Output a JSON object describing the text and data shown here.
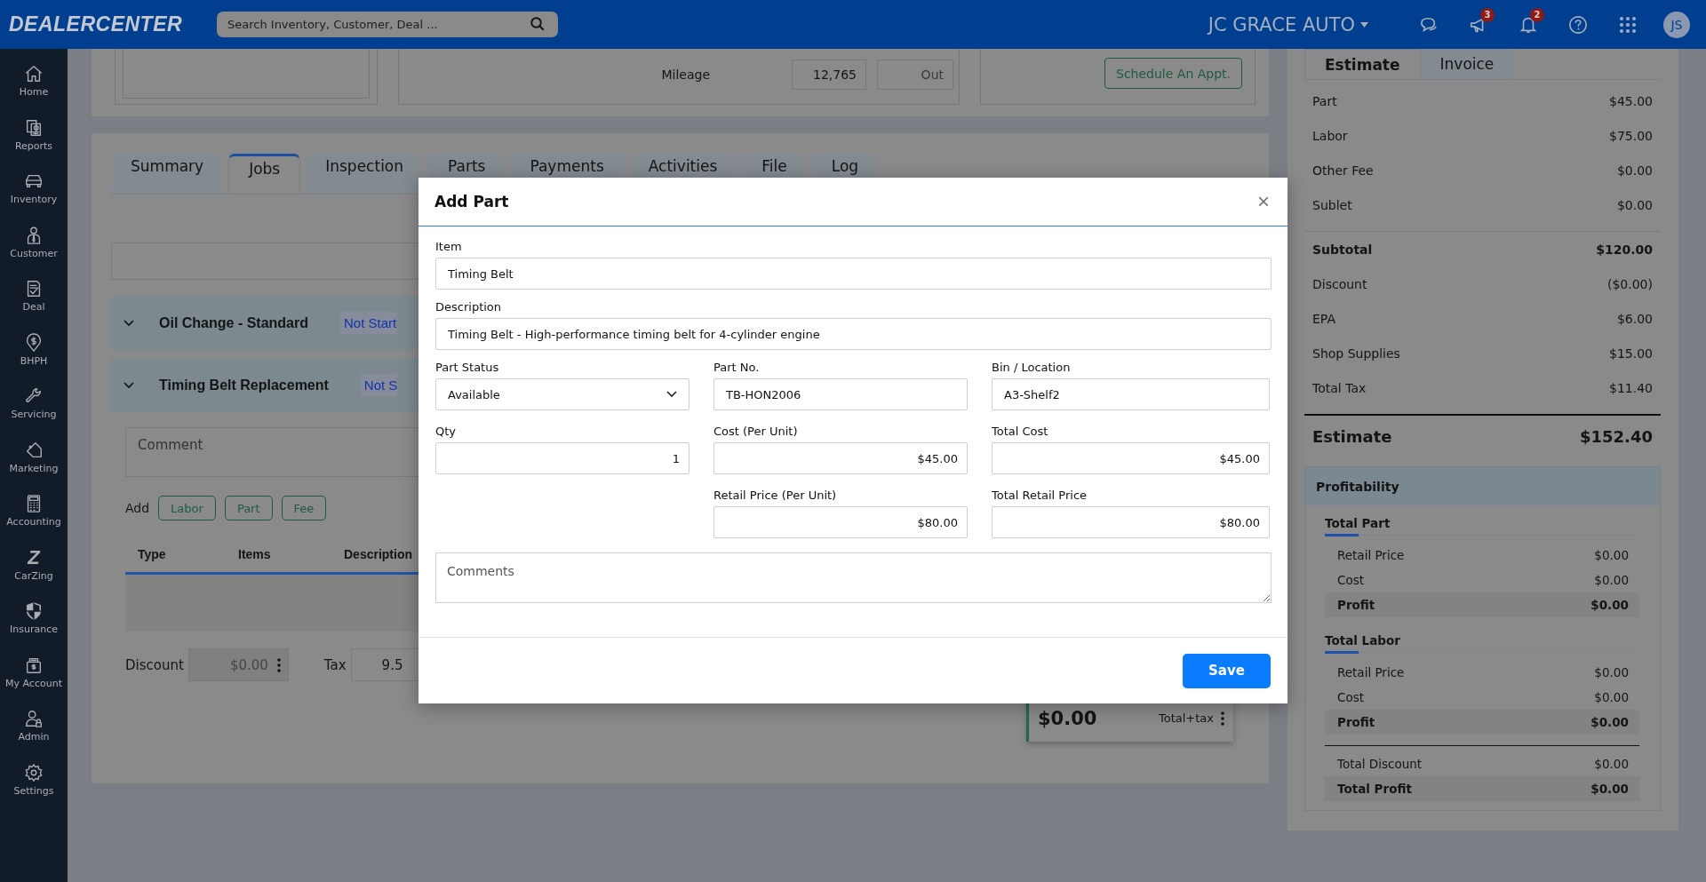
{
  "header": {
    "logo": "DEALERCENTER",
    "search": {
      "placeholder": "Search Inventory, Customer, Deal ..."
    },
    "dealer": "JC GRACE AUTO",
    "announcements_badge": "3",
    "alerts_badge": "2",
    "avatar": "JS"
  },
  "sidebar": {
    "items": [
      {
        "label": "Home"
      },
      {
        "label": "Reports"
      },
      {
        "label": "Inventory"
      },
      {
        "label": "Customer"
      },
      {
        "label": "Deal"
      },
      {
        "label": "BHPH"
      },
      {
        "label": "Servicing"
      },
      {
        "label": "Marketing"
      },
      {
        "label": "Accounting"
      },
      {
        "label": "CarZing",
        "glyph": "Z"
      },
      {
        "label": "Insurance"
      },
      {
        "label": "My Account"
      },
      {
        "label": "Admin"
      },
      {
        "label": "Settings"
      }
    ]
  },
  "vehicle_panel": {
    "mileage_label": "Mileage",
    "mileage": "12,765",
    "mileage_out_placeholder": "Out",
    "schedule_button": "Schedule An Appt."
  },
  "job_tabs": [
    {
      "label": "Summary",
      "selected": false
    },
    {
      "label": "Jobs",
      "selected": true
    },
    {
      "label": "Inspection",
      "selected": false
    },
    {
      "label": "Parts",
      "selected": false
    },
    {
      "label": "Payments",
      "selected": false
    },
    {
      "label": "Activities",
      "selected": false
    },
    {
      "label": "File",
      "selected": false
    },
    {
      "label": "Log",
      "selected": false
    }
  ],
  "jobs": [
    {
      "title": "Oil Change - Standard",
      "status": "Not Start"
    },
    {
      "title": "Timing Belt Replacement",
      "status": "Not S"
    }
  ],
  "comment": {
    "placeholder": "Comment"
  },
  "add": {
    "label": "Add",
    "buttons": [
      "Labor",
      "Part",
      "Fee"
    ]
  },
  "lines_table": {
    "columns": [
      "Type",
      "Items",
      "Description"
    ]
  },
  "discount": {
    "label": "Discount",
    "value": "$0.00"
  },
  "tax": {
    "label": "Tax",
    "value": "9.5"
  },
  "total": {
    "amount": "$0.00",
    "label": "Total+tax"
  },
  "summary_tabs": [
    {
      "label": "Estimate",
      "selected": true
    },
    {
      "label": "Invoice",
      "selected": false
    }
  ],
  "summary_rows": [
    {
      "label": "Part",
      "value": "$45.00",
      "kind": "plain"
    },
    {
      "label": "Labor",
      "value": "$75.00",
      "kind": "plain"
    },
    {
      "label": "Other Fee",
      "value": "$0.00",
      "kind": "plain"
    },
    {
      "label": "Sublet",
      "value": "$0.00",
      "kind": "plain"
    },
    {
      "label": "Subtotal",
      "value": "$120.00",
      "kind": "subtotal"
    },
    {
      "label": "Discount",
      "value": "($0.00)",
      "kind": "plain"
    },
    {
      "label": "EPA",
      "value": "$6.00",
      "kind": "plain"
    },
    {
      "label": "Shop Supplies",
      "value": "$15.00",
      "kind": "plain"
    },
    {
      "label": "Total Tax",
      "value": "$11.40",
      "kind": "plain"
    },
    {
      "label": "Estimate",
      "value": "$152.40",
      "kind": "total"
    }
  ],
  "profitability": {
    "title": "Profitability",
    "groups": [
      {
        "title": "Total Part",
        "rows": [
          {
            "label": "Retail Price",
            "value": "$0.00",
            "kind": "plain"
          },
          {
            "label": "Cost",
            "value": "$0.00",
            "kind": "plain"
          },
          {
            "label": "Profit",
            "value": "$0.00",
            "kind": "bold"
          }
        ]
      },
      {
        "title": "Total Labor",
        "rows": [
          {
            "label": "Retail Price",
            "value": "$0.00",
            "kind": "plain"
          },
          {
            "label": "Cost",
            "value": "$0.00",
            "kind": "plain"
          },
          {
            "label": "Profit",
            "value": "$0.00",
            "kind": "bold"
          }
        ]
      }
    ],
    "totals": [
      {
        "label": "Total Discount",
        "value": "$0.00",
        "kind": "plain"
      },
      {
        "label": "Total Profit",
        "value": "$0.00",
        "kind": "bold"
      }
    ]
  },
  "modal": {
    "title": "Add Part",
    "close": "×",
    "item": {
      "label": "Item",
      "value": "Timing Belt"
    },
    "description": {
      "label": "Description",
      "value": "Timing Belt - High-performance timing belt for 4-cylinder engine"
    },
    "rows": [
      [
        {
          "label": "Part Status",
          "value": "Available",
          "kind": "select"
        },
        {
          "label": "Part No.",
          "value": "TB-HON2006",
          "kind": "text"
        },
        {
          "label": "Bin / Location",
          "value": "A3-Shelf2",
          "kind": "text"
        }
      ],
      [
        {
          "label": "Qty",
          "value": "1",
          "kind": "amount"
        },
        {
          "label": "Cost (Per Unit)",
          "value": "$45.00",
          "kind": "amount"
        },
        {
          "label": "Total Cost",
          "value": "$45.00",
          "kind": "amount"
        }
      ],
      [
        "",
        {
          "label": "Retail Price (Per Unit)",
          "value": "$80.00",
          "kind": "amount"
        },
        {
          "label": "Total Retail Price",
          "value": "$80.00",
          "kind": "amount"
        }
      ]
    ],
    "comments": {
      "placeholder": "Comments"
    },
    "save": "Save"
  }
}
